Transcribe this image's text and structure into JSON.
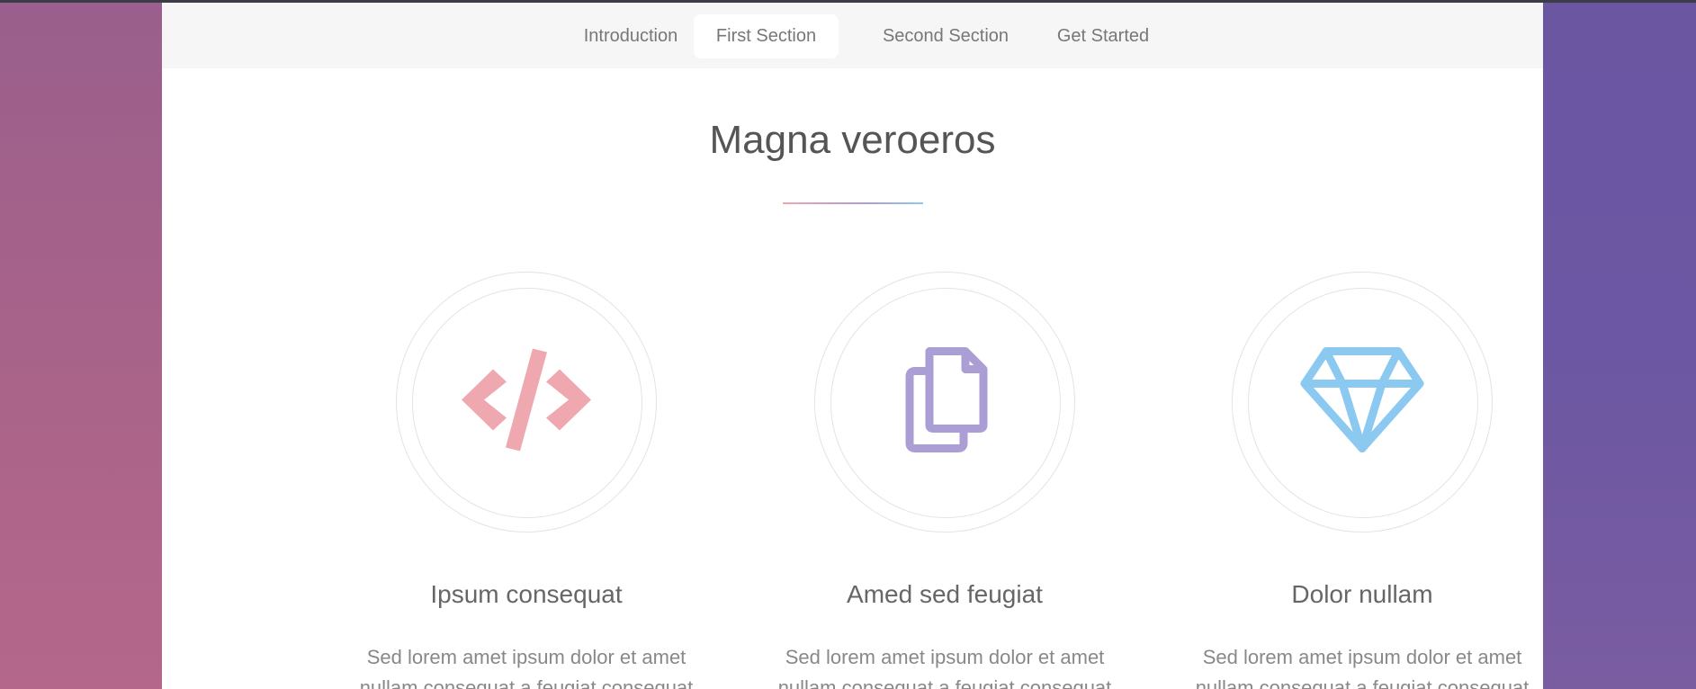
{
  "nav": {
    "items": [
      {
        "label": "Introduction",
        "active": false
      },
      {
        "label": "First Section",
        "active": true
      },
      {
        "label": "Second Section",
        "active": false
      },
      {
        "label": "Get Started",
        "active": false
      }
    ]
  },
  "main": {
    "title": "Magna veroeros",
    "features": [
      {
        "icon": "code-icon",
        "color": "#efa8b0",
        "title": "Ipsum consequat",
        "text": "Sed lorem amet ipsum dolor et amet nullam consequat a feugiat consequat"
      },
      {
        "icon": "copy-icon",
        "color": "#ab9ed5",
        "title": "Amed sed feugiat",
        "text": "Sed lorem amet ipsum dolor et amet nullam consequat a feugiat consequat"
      },
      {
        "icon": "diamond-icon",
        "color": "#8cc9f0",
        "title": "Dolor nullam",
        "text": "Sed lorem amet ipsum dolor et amet nullam consequat a feugiat consequat"
      }
    ]
  }
}
